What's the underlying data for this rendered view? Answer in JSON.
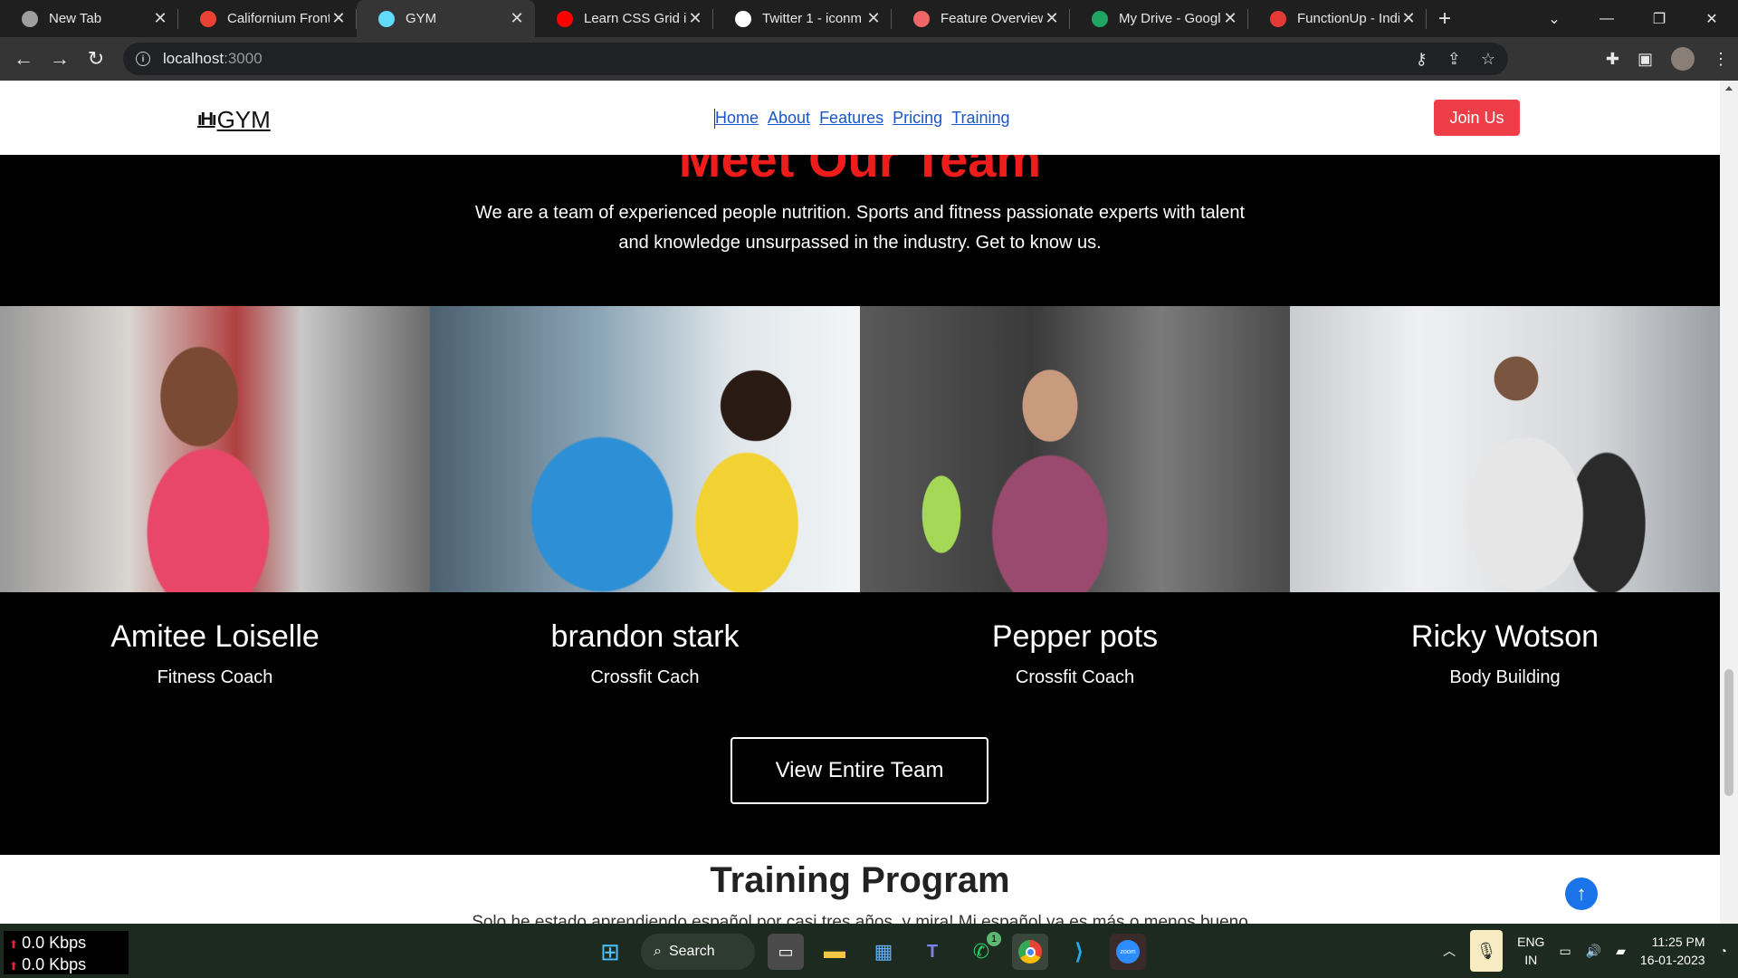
{
  "browser": {
    "tabs": [
      {
        "title": "New Tab",
        "icon": "chrome-icon",
        "color": "#9e9e9e"
      },
      {
        "title": "Californium Front",
        "icon": "gmail-icon",
        "color": "#ea4335"
      },
      {
        "title": "GYM",
        "icon": "react-icon",
        "color": "#61dafb",
        "active": true
      },
      {
        "title": "Learn CSS Grid in",
        "icon": "youtube-icon",
        "color": "#ff0000"
      },
      {
        "title": "Twitter 1 - iconm",
        "icon": "iconmonstr-icon",
        "color": "#ffffff"
      },
      {
        "title": "Feature Overview",
        "icon": "feature-icon",
        "color": "#e66"
      },
      {
        "title": "My Drive - Googl",
        "icon": "drive-icon",
        "color": "#1fa463"
      },
      {
        "title": "FunctionUp - Indi",
        "icon": "functionup-icon",
        "color": "#e53935"
      }
    ],
    "new_tab_symbol": "+",
    "url_host": "localhost",
    "url_port": ":3000"
  },
  "navbar": {
    "logo_text": "GYM",
    "links": [
      "Home",
      "About",
      "Features",
      "Pricing",
      "Training"
    ],
    "join_label": "Join Us"
  },
  "team": {
    "title": "Meet Our Team",
    "intro": "We are a team of experienced people nutrition. Sports and fitness passionate experts with talent and knowledge unsurpassed in the industry. Get to know us.",
    "members": [
      {
        "name": "Amitee Loiselle",
        "role": "Fitness Coach"
      },
      {
        "name": "brandon stark",
        "role": "Crossfit Cach"
      },
      {
        "name": "Pepper pots",
        "role": "Crossfit Coach"
      },
      {
        "name": "Ricky Wotson",
        "role": "Body Building"
      }
    ],
    "view_button": "View Entire Team"
  },
  "training": {
    "title": "Training Program",
    "text": "Solo he estado aprendiendo español por casi tres años, y mira! Mi español ya es más o menos bueno"
  },
  "taskbar": {
    "upload": "0.0 Kbps",
    "download": "0.0 Kbps",
    "search_label": "Search",
    "whatsapp_badge": "1",
    "lang_top": "ENG",
    "lang_bottom": "IN",
    "time": "11:25 PM",
    "date": "16-01-2023"
  }
}
